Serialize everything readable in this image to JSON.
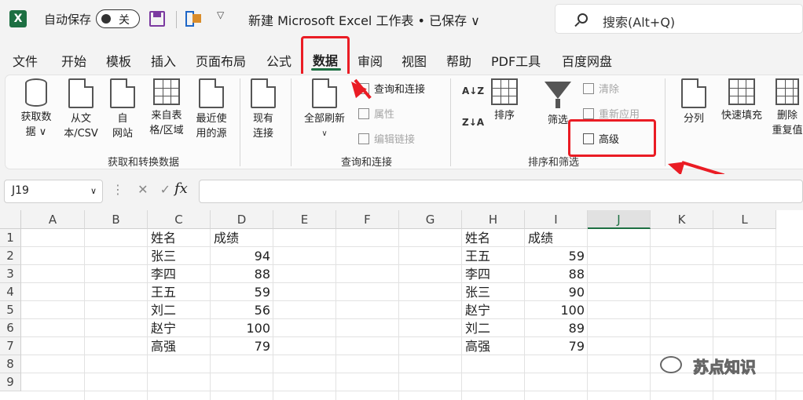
{
  "titlebar": {
    "logo": "X",
    "autosave_label": "自动保存",
    "toggle_state": "关",
    "document_title": "新建 Microsoft Excel 工作表 • 已保存 ∨",
    "search_placeholder": "搜索(Alt+Q)"
  },
  "menu": {
    "items": [
      "文件",
      "开始",
      "模板",
      "插入",
      "页面布局",
      "公式",
      "数据",
      "审阅",
      "视图",
      "帮助",
      "PDF工具",
      "百度网盘"
    ],
    "active": "数据"
  },
  "ribbon": {
    "get_data": {
      "label": "获取和转换数据",
      "buttons": [
        {
          "line1": "获取数",
          "line2": "据 ∨"
        },
        {
          "line1": "从文",
          "line2": "本/CSV"
        },
        {
          "line1": "自",
          "line2": "网站"
        },
        {
          "line1": "来自表",
          "line2": "格/区域"
        },
        {
          "line1": "最近使",
          "line2": "用的源"
        },
        {
          "line1": "现有",
          "line2": "连接"
        }
      ]
    },
    "queries": {
      "label": "查询和连接",
      "refresh_all": "全部刷新",
      "refresh_dropdown": "∨",
      "query_connections": "查询和连接",
      "properties": "属性",
      "edit_links": "编辑链接"
    },
    "sort_filter": {
      "label": "排序和筛选",
      "sort_az": "A↓Z",
      "sort_za": "Z↓A",
      "sort": "排序",
      "filter": "筛选",
      "clear": "清除",
      "reapply": "重新应用",
      "advanced": "高级"
    },
    "data_tools": {
      "split": "分列",
      "flash_fill": "快速填充",
      "remove_dup_line1": "删除",
      "remove_dup_line2": "重复值"
    }
  },
  "formula_bar": {
    "name_box": "J19",
    "formula": ""
  },
  "sheet": {
    "columns": [
      "A",
      "B",
      "C",
      "D",
      "E",
      "F",
      "G",
      "H",
      "I",
      "J",
      "K",
      "L"
    ],
    "selected_column": "J",
    "rows": [
      "1",
      "2",
      "3",
      "4",
      "5",
      "6",
      "7",
      "8",
      "9"
    ],
    "table1": {
      "headers": [
        "姓名",
        "成绩"
      ],
      "rows": [
        [
          "张三",
          "94"
        ],
        [
          "李四",
          "88"
        ],
        [
          "王五",
          "59"
        ],
        [
          "刘二",
          "56"
        ],
        [
          "赵宁",
          "100"
        ],
        [
          "高强",
          "79"
        ]
      ]
    },
    "table2": {
      "headers": [
        "姓名",
        "成绩"
      ],
      "rows": [
        [
          "王五",
          "59"
        ],
        [
          "李四",
          "88"
        ],
        [
          "张三",
          "90"
        ],
        [
          "赵宁",
          "100"
        ],
        [
          "刘二",
          "89"
        ],
        [
          "高强",
          "79"
        ]
      ]
    }
  },
  "watermark": "苏点知识",
  "colors": {
    "excel_green": "#1d6f42",
    "highlight_red": "#ea1c24"
  }
}
